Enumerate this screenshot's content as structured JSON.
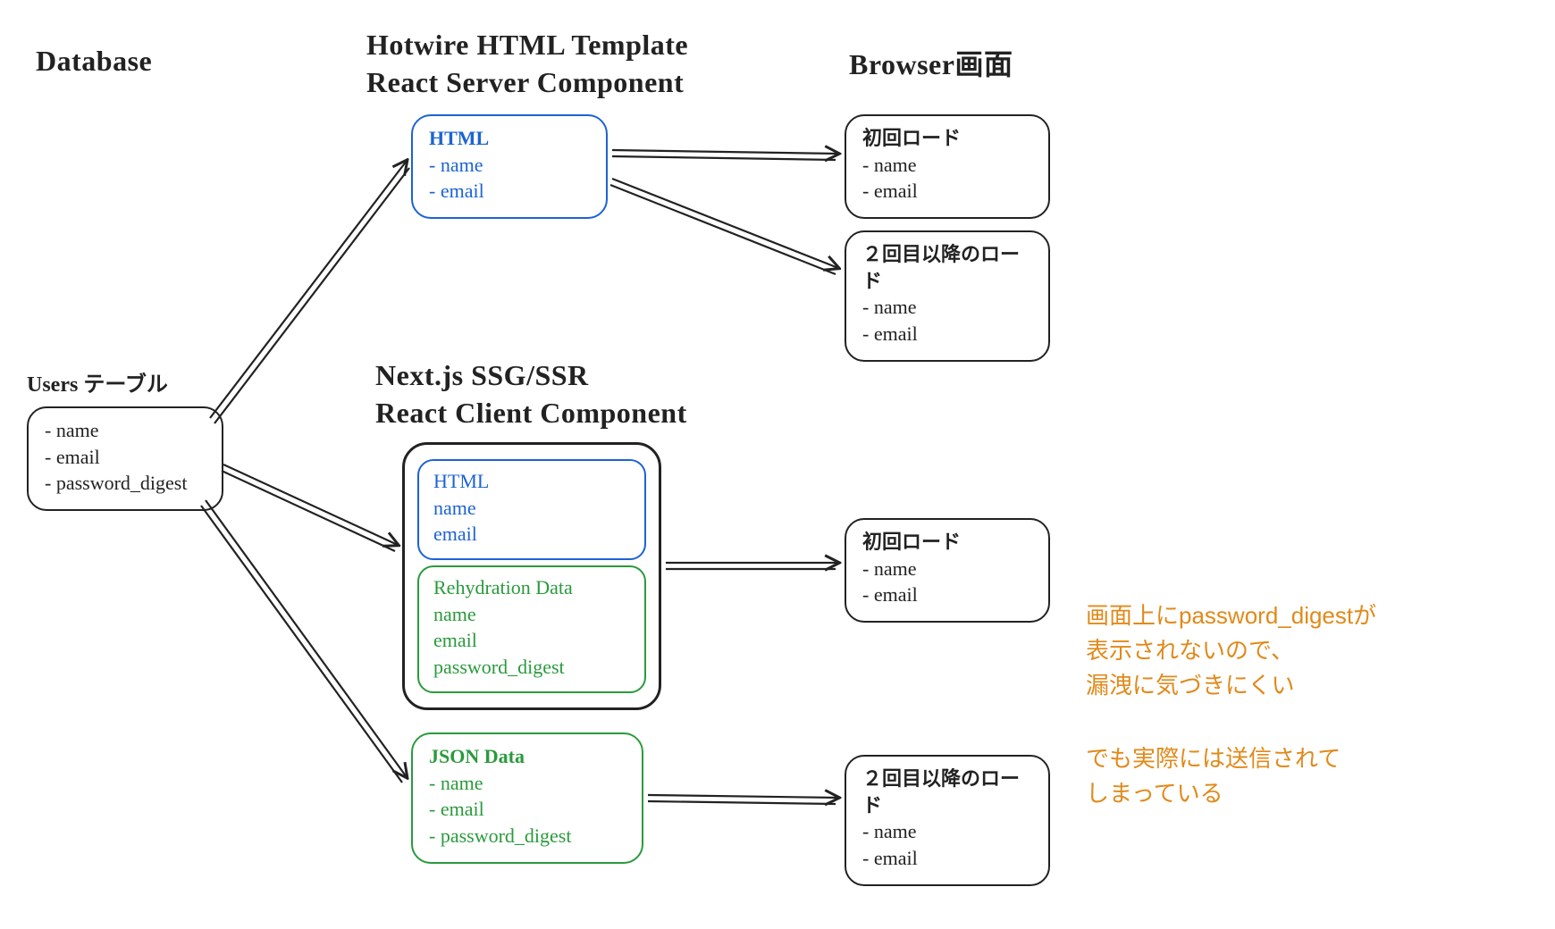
{
  "headings": {
    "database": "Database",
    "hotwire_line1": "Hotwire HTML Template",
    "hotwire_line2": "React Server Component",
    "browser": "Browser画面",
    "nextjs_line1": "Next.js SSG/SSR",
    "nextjs_line2": "React Client Component"
  },
  "boxes": {
    "users_table": {
      "title": "Users テーブル",
      "items": [
        "name",
        "email",
        "password_digest"
      ]
    },
    "hotwire_html": {
      "title": "HTML",
      "items": [
        "name",
        "email"
      ]
    },
    "browser_first_load_top": {
      "title": "初回ロード",
      "items": [
        "name",
        "email"
      ]
    },
    "browser_second_load_top": {
      "title": "２回目以降のロード",
      "items": [
        "name",
        "email"
      ]
    },
    "nextjs_html": {
      "title": "HTML",
      "items": [
        "name",
        "email"
      ]
    },
    "nextjs_rehydration": {
      "title": "Rehydration Data",
      "items": [
        "name",
        "email",
        "password_digest"
      ]
    },
    "nextjs_json": {
      "title": "JSON Data",
      "items": [
        "name",
        "email",
        "password_digest"
      ]
    },
    "browser_first_load_bottom": {
      "title": "初回ロード",
      "items": [
        "name",
        "email"
      ]
    },
    "browser_second_load_bottom": {
      "title": "２回目以降のロード",
      "items": [
        "name",
        "email"
      ]
    }
  },
  "notes": {
    "orange1_line1": "画面上にpassword_digestが",
    "orange1_line2": "表示されないので、",
    "orange1_line3": "漏洩に気づきにくい",
    "orange2_line1": "でも実際には送信されて",
    "orange2_line2": "しまっている"
  }
}
